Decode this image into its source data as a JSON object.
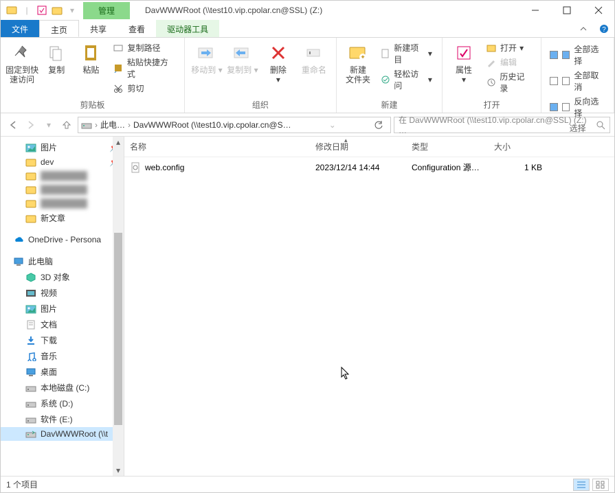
{
  "title": "DavWWWRoot (\\\\test10.vip.cpolar.cn@SSL) (Z:)",
  "context_tab": "管理",
  "tabs": {
    "file": "文件",
    "home": "主页",
    "share": "共享",
    "view": "查看",
    "tools": "驱动器工具"
  },
  "ribbon": {
    "clipboard": {
      "pin": "固定到快\n速访问",
      "copy": "复制",
      "paste": "粘贴",
      "cut": "剪切",
      "copy_path": "复制路径",
      "paste_shortcut": "粘贴快捷方式",
      "group": "剪贴板"
    },
    "organize": {
      "move_to": "移动到",
      "copy_to": "复制到",
      "delete": "删除",
      "rename": "重命名",
      "group": "组织"
    },
    "new": {
      "new_folder": "新建\n文件夹",
      "new_item": "新建项目",
      "easy_access": "轻松访问",
      "group": "新建"
    },
    "open": {
      "properties": "属性",
      "open": "打开",
      "edit": "编辑",
      "history": "历史记录",
      "group": "打开"
    },
    "select": {
      "all": "全部选择",
      "none": "全部取消",
      "invert": "反向选择",
      "group": "选择"
    }
  },
  "addr": {
    "root": "此电…",
    "path": "DavWWWRoot (\\\\test10.vip.cpolar.cn@S…",
    "search_placeholder": "在 DavWWWRoot (\\\\test10.vip.cpolar.cn@SSL) (Z:) …"
  },
  "tree": [
    {
      "label": "图片",
      "icon": "pictures",
      "pinned": true,
      "level": 2
    },
    {
      "label": "dev",
      "icon": "folder",
      "pinned": true,
      "level": 2
    },
    {
      "label": "",
      "icon": "folder",
      "blur": true,
      "level": 2
    },
    {
      "label": "",
      "icon": "folder",
      "blur": true,
      "level": 2
    },
    {
      "label": "",
      "icon": "folder",
      "blur": true,
      "level": 2
    },
    {
      "label": "新文章",
      "icon": "folder",
      "level": 2
    },
    {
      "label": "OneDrive - Persona",
      "icon": "onedrive",
      "level": 1,
      "spaced": true
    },
    {
      "label": "此电脑",
      "icon": "thispc",
      "level": 1,
      "spaced": true
    },
    {
      "label": "3D 对象",
      "icon": "3d",
      "level": 2
    },
    {
      "label": "视频",
      "icon": "video",
      "level": 2
    },
    {
      "label": "图片",
      "icon": "pictures",
      "level": 2
    },
    {
      "label": "文档",
      "icon": "docs",
      "level": 2
    },
    {
      "label": "下载",
      "icon": "downloads",
      "level": 2
    },
    {
      "label": "音乐",
      "icon": "music",
      "level": 2
    },
    {
      "label": "桌面",
      "icon": "desktop",
      "level": 2
    },
    {
      "label": "本地磁盘 (C:)",
      "icon": "drive",
      "level": 2
    },
    {
      "label": "系统 (D:)",
      "icon": "drive",
      "level": 2
    },
    {
      "label": "软件 (E:)",
      "icon": "drive",
      "level": 2
    },
    {
      "label": "DavWWWRoot (\\\\t",
      "icon": "netdrive",
      "level": 2,
      "selected": true
    }
  ],
  "columns": {
    "name": "名称",
    "modified": "修改日期",
    "type": "类型",
    "size": "大小"
  },
  "files": [
    {
      "name": "web.config",
      "date": "2023/12/14 14:44",
      "type": "Configuration 源…",
      "size": "1 KB"
    }
  ],
  "status": "1 个项目"
}
